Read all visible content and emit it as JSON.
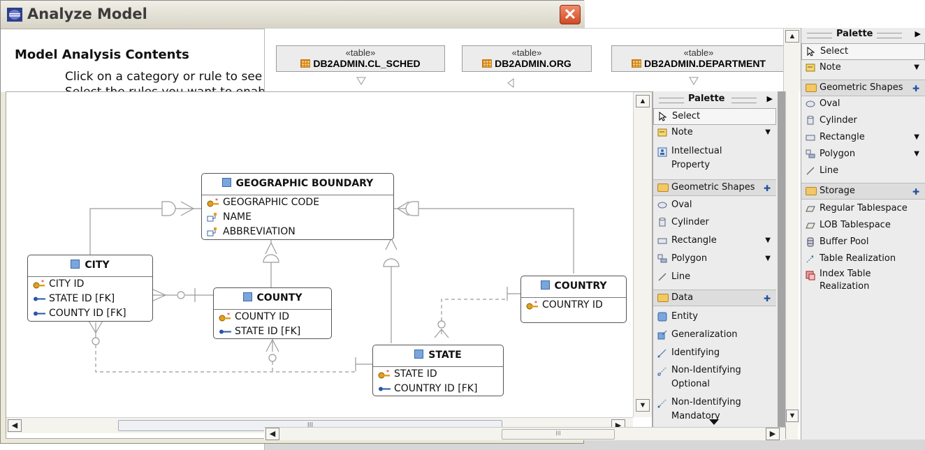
{
  "window_analyze": {
    "title": "Analyze Model",
    "close_glyph": "✕",
    "section_title": "Model Analysis Contents",
    "help_line1": "Click on a category or rule to see i",
    "help_line2": "Select the rules you want to enab"
  },
  "window_tables": {
    "tables": [
      {
        "stereotype": "«table»",
        "name": "DB2ADMIN.CL_SCHED"
      },
      {
        "stereotype": "«table»",
        "name": "DB2ADMIN.ORG"
      },
      {
        "stereotype": "«table»",
        "name": "DB2ADMIN.DEPARTMENT"
      }
    ]
  },
  "palette_right": {
    "title": "Palette",
    "select": "Select",
    "note": "Note",
    "drawer_shapes": "Geometric Shapes",
    "oval": "Oval",
    "cylinder": "Cylinder",
    "rectangle": "Rectangle",
    "polygon": "Polygon",
    "line": "Line",
    "drawer_storage": "Storage",
    "regular_tablespace": "Regular Tablespace",
    "lob_tablespace": "LOB Tablespace",
    "buffer_pool": "Buffer Pool",
    "table_realization": "Table Realization",
    "index_table_realization_1": "Index Table",
    "index_table_realization_2": "Realization"
  },
  "palette_main": {
    "title": "Palette",
    "select": "Select",
    "note": "Note",
    "intellectual_property_1": "Intellectual",
    "intellectual_property_2": "Property",
    "drawer_shapes": "Geometric Shapes",
    "oval": "Oval",
    "cylinder": "Cylinder",
    "rectangle": "Rectangle",
    "polygon": "Polygon",
    "line": "Line",
    "drawer_data": "Data",
    "entity": "Entity",
    "generalization": "Generalization",
    "identifying": "Identifying",
    "non_ident_optional_1": "Non-Identifying",
    "non_ident_optional_2": "Optional",
    "non_ident_mandatory_1": "Non-Identifying",
    "non_ident_mandatory_2": "Mandatory"
  },
  "diagram": {
    "entities": {
      "geographic_boundary": {
        "name": "GEOGRAPHIC BOUNDARY",
        "attrs": [
          "GEOGRAPHIC CODE",
          "NAME",
          "ABBREVIATION"
        ]
      },
      "city": {
        "name": "CITY",
        "attrs": [
          "CITY ID",
          "STATE ID [FK]",
          "COUNTY ID [FK]"
        ]
      },
      "county": {
        "name": "COUNTY",
        "attrs": [
          "COUNTY ID",
          "STATE ID [FK]"
        ]
      },
      "country": {
        "name": "COUNTRY",
        "attrs": [
          "COUNTRY ID"
        ]
      },
      "state": {
        "name": "STATE",
        "attrs": [
          "STATE ID",
          "COUNTRY ID [FK]"
        ]
      }
    },
    "scroll_thumb_grip": "III"
  },
  "colors": {
    "pk_key": "#e0a020",
    "fk_key": "#2a55a8",
    "entity_icon": "#7aa6dc",
    "close_button": "#d9532d"
  }
}
